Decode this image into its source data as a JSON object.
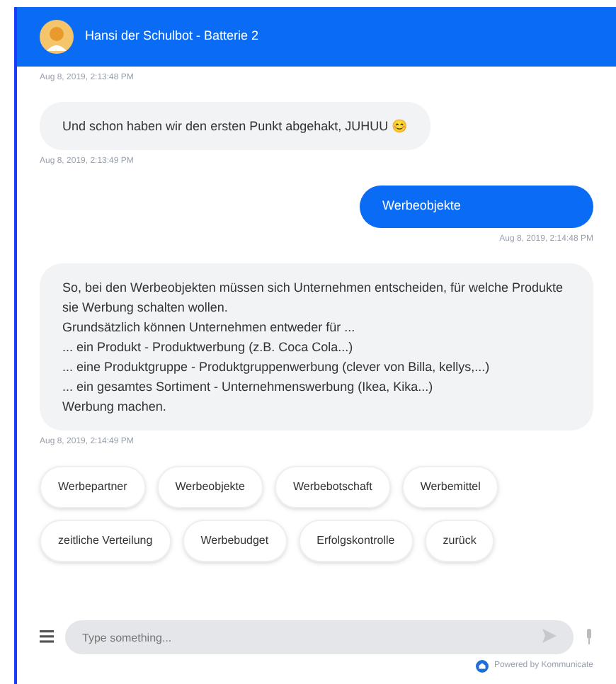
{
  "header": {
    "title": "Hansi der Schulbot - Batterie 2"
  },
  "messages": [
    {
      "kind": "timestamp",
      "text": "Aug 8, 2019, 2:13:48 PM"
    },
    {
      "kind": "bot",
      "lines": [
        "Und schon haben wir den ersten Punkt abgehakt, JUHUU 😊"
      ]
    },
    {
      "kind": "timestamp",
      "text": "Aug 8, 2019, 2:13:49 PM"
    },
    {
      "kind": "user",
      "lines": [
        "Werbeobjekte"
      ]
    },
    {
      "kind": "user_timestamp",
      "text": "Aug 8, 2019, 2:14:48 PM"
    },
    {
      "kind": "bot",
      "lines": [
        "So, bei den Werbeobjekten müssen sich Unternehmen entscheiden, für welche Produkte sie Werbung schalten wollen.",
        "Grundsätzlich können Unternehmen entweder für ...",
        "... ein Produkt - Produktwerbung (z.B. Coca Cola...)",
        "... eine Produktgruppe - Produktgruppenwerbung (clever von Billa, kellys,...)",
        "... ein gesamtes Sortiment - Unternehmenswerbung (Ikea, Kika...)",
        "Werbung machen."
      ]
    },
    {
      "kind": "timestamp",
      "text": "Aug 8, 2019, 2:14:49 PM"
    }
  ],
  "quick_replies": [
    "Werbepartner",
    "Werbeobjekte",
    "Werbebotschaft",
    "Werbemittel",
    "zeitliche Verteilung",
    "Werbebudget",
    "Erfolgskontrolle",
    "zurück"
  ],
  "composer": {
    "placeholder": "Type something..."
  },
  "footer": {
    "text": "Powered by Kommunicate"
  }
}
